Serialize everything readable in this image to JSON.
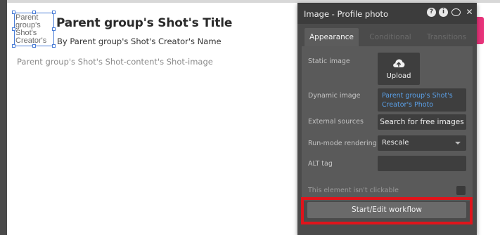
{
  "canvas": {
    "image_placeholder_text": "Parent group's Shot's Creator's",
    "title": "Parent group's Shot's Title",
    "byline": "By Parent group's Shot's Creator's Name",
    "content_image": "Parent group's Shot's Shot-content's Shot-image"
  },
  "panel": {
    "title": "Image - Profile photo",
    "icons": [
      "help-icon",
      "info-icon",
      "comment-icon",
      "close-icon"
    ],
    "help_glyph": "?",
    "info_glyph": "i",
    "close_glyph": "✕",
    "tabs": [
      {
        "label": "Appearance",
        "active": true
      },
      {
        "label": "Conditional",
        "active": false
      },
      {
        "label": "Transitions",
        "active": false
      }
    ],
    "properties": {
      "static_image_label": "Static image",
      "upload_label": "Upload",
      "dynamic_image_label": "Dynamic image",
      "dynamic_image_value": "Parent group's Shot's Creator's Photo",
      "external_sources_label": "External sources",
      "search_button": "Search for free images",
      "run_mode_label": "Run-mode rendering",
      "run_mode_value": "Rescale",
      "alt_tag_label": "ALT tag",
      "alt_tag_value": "",
      "not_clickable_label": "This element isn't clickable"
    },
    "workflow_button": "Start/Edit workflow"
  },
  "colors": {
    "panel_bg": "#4b4b4b",
    "header_bg": "#3c3c3c",
    "dynamic_link": "#5aa0e8",
    "highlight": "#e0141b",
    "selection": "#4a7dd6",
    "pink_accent": "#e8337a"
  }
}
